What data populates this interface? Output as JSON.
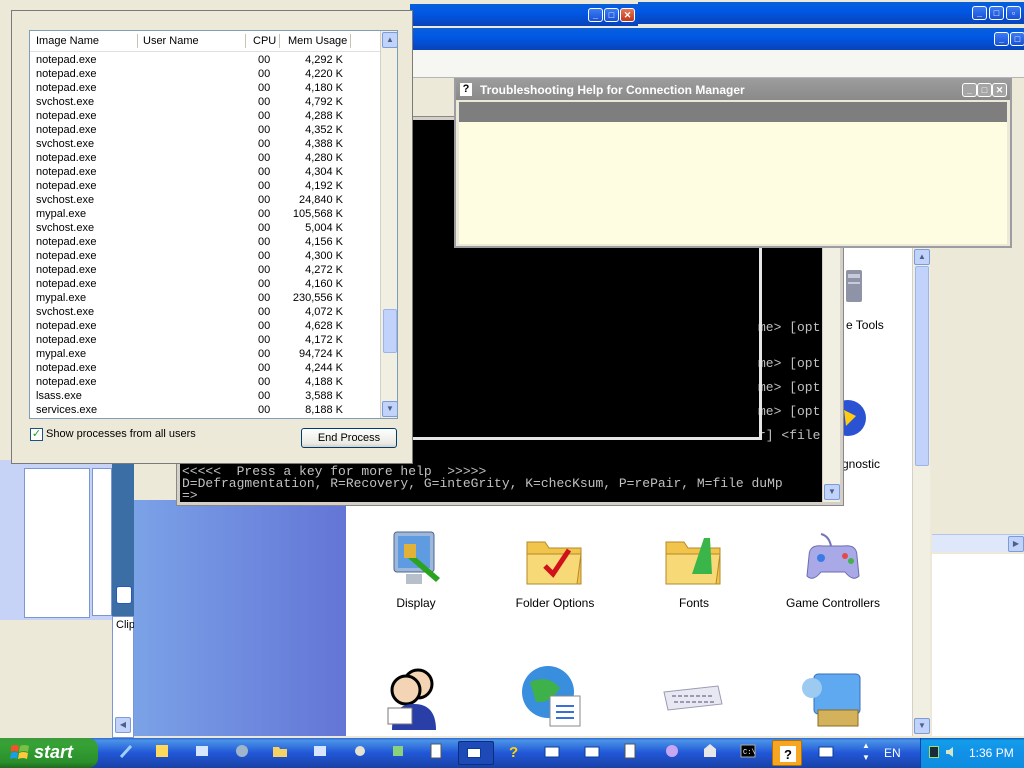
{
  "task_manager": {
    "columns": [
      "Image Name",
      "User Name",
      "CPU",
      "Mem Usage"
    ],
    "rows": [
      {
        "image": "notepad.exe",
        "cpu": "00",
        "mem": "4,292 K"
      },
      {
        "image": "notepad.exe",
        "cpu": "00",
        "mem": "4,220 K"
      },
      {
        "image": "notepad.exe",
        "cpu": "00",
        "mem": "4,180 K"
      },
      {
        "image": "svchost.exe",
        "cpu": "00",
        "mem": "4,792 K"
      },
      {
        "image": "notepad.exe",
        "cpu": "00",
        "mem": "4,288 K"
      },
      {
        "image": "notepad.exe",
        "cpu": "00",
        "mem": "4,352 K"
      },
      {
        "image": "svchost.exe",
        "cpu": "00",
        "mem": "4,388 K"
      },
      {
        "image": "notepad.exe",
        "cpu": "00",
        "mem": "4,280 K"
      },
      {
        "image": "notepad.exe",
        "cpu": "00",
        "mem": "4,304 K"
      },
      {
        "image": "notepad.exe",
        "cpu": "00",
        "mem": "4,192 K"
      },
      {
        "image": "svchost.exe",
        "cpu": "00",
        "mem": "24,840 K"
      },
      {
        "image": "mypal.exe",
        "cpu": "00",
        "mem": "105,568 K"
      },
      {
        "image": "svchost.exe",
        "cpu": "00",
        "mem": "5,004 K"
      },
      {
        "image": "notepad.exe",
        "cpu": "00",
        "mem": "4,156 K"
      },
      {
        "image": "notepad.exe",
        "cpu": "00",
        "mem": "4,300 K"
      },
      {
        "image": "notepad.exe",
        "cpu": "00",
        "mem": "4,272 K"
      },
      {
        "image": "notepad.exe",
        "cpu": "00",
        "mem": "4,160 K"
      },
      {
        "image": "mypal.exe",
        "cpu": "00",
        "mem": "230,556 K"
      },
      {
        "image": "svchost.exe",
        "cpu": "00",
        "mem": "4,072 K"
      },
      {
        "image": "notepad.exe",
        "cpu": "00",
        "mem": "4,628 K"
      },
      {
        "image": "notepad.exe",
        "cpu": "00",
        "mem": "4,172 K"
      },
      {
        "image": "mypal.exe",
        "cpu": "00",
        "mem": "94,724 K"
      },
      {
        "image": "notepad.exe",
        "cpu": "00",
        "mem": "4,244 K"
      },
      {
        "image": "notepad.exe",
        "cpu": "00",
        "mem": "4,188 K"
      },
      {
        "image": "lsass.exe",
        "cpu": "00",
        "mem": "3,588 K"
      },
      {
        "image": "services.exe",
        "cpu": "00",
        "mem": "8,188 K"
      }
    ],
    "show_all_label": "Show processes from all users",
    "show_all_checked": true,
    "end_process_label": "End Process"
  },
  "troubleshoot_window": {
    "title": "Troubleshooting Help for Connection Manager",
    "title_icon": "?"
  },
  "console": {
    "right_fragments": [
      "me> [opt",
      "me> [opt",
      "me> [opt",
      "me> [opt",
      "r] <file"
    ],
    "help_line": "<<<<<  Press a key for more help  >>>>>",
    "keys_line": "D=Defragmentation, R=Recovery, G=inteGrity, K=checKsum, P=rePair, M=file duMp",
    "prompt": "=>"
  },
  "control_panel": {
    "partial_labels": [
      "e Tools",
      "gnostic"
    ],
    "items": [
      {
        "label": "Display",
        "icon": "display-icon"
      },
      {
        "label": "Folder Options",
        "icon": "folder-options-icon"
      },
      {
        "label": "Fonts",
        "icon": "fonts-icon"
      },
      {
        "label": "Game Controllers",
        "icon": "game-controllers-icon"
      }
    ]
  },
  "left_partial": {
    "clip_label": "Clip"
  },
  "taskbar": {
    "start_label": "start",
    "language": "EN",
    "clock": "1:36 PM"
  },
  "colors": {
    "xp_blue": "#0058e6",
    "desktop_blue": "#3a6ea5",
    "console_bg": "#000000",
    "help_bg": "#fffde1",
    "start_green": "#36a336"
  }
}
